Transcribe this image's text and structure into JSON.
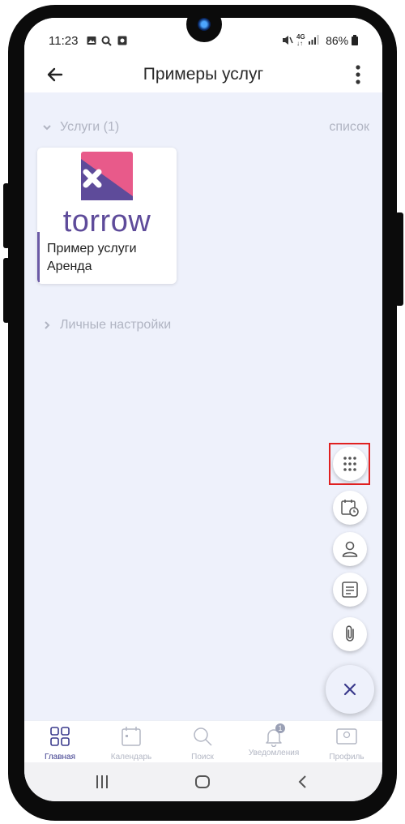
{
  "status_bar": {
    "time": "11:23",
    "icons_left": [
      "gallery-icon",
      "search-icon",
      "screenshot-icon"
    ],
    "icons_right": [
      "mute-icon",
      "4g-icon",
      "signal-icon"
    ],
    "battery": "86%"
  },
  "header": {
    "title": "Примеры услуг",
    "back_icon": "arrow-left-icon",
    "menu_icon": "more-vertical-icon"
  },
  "services_section": {
    "label": "Услуги (1)",
    "view_toggle": "список",
    "expanded": true
  },
  "service_card": {
    "logo_text": "torrow",
    "title_line1": "Пример услуги",
    "title_line2": "Аренда"
  },
  "settings_section": {
    "label": "Личные настройки",
    "expanded": false
  },
  "fab_menu": {
    "items": [
      "apps-grid-icon",
      "calendar-clock-icon",
      "person-icon",
      "note-icon",
      "paperclip-icon"
    ],
    "close_icon": "close-icon",
    "highlighted_item": "apps-grid-icon"
  },
  "bottom_nav": {
    "items": [
      {
        "label": "Главная",
        "icon": "home-grid-icon",
        "active": true
      },
      {
        "label": "Календарь",
        "icon": "calendar-icon",
        "active": false
      },
      {
        "label": "Поиск",
        "icon": "search-icon",
        "active": false
      },
      {
        "label": "Уведомления",
        "icon": "bell-icon",
        "active": false,
        "badge": "1"
      },
      {
        "label": "Профиль",
        "icon": "profile-card-icon",
        "active": false
      }
    ]
  },
  "system_nav": [
    "recents-icon",
    "home-icon",
    "back-icon"
  ],
  "colors": {
    "accent": "#3a3a8c",
    "brand_purple": "#5e4b9a",
    "brand_pink": "#e85a8a",
    "highlight": "#e02020",
    "background": "#eef1fb"
  }
}
